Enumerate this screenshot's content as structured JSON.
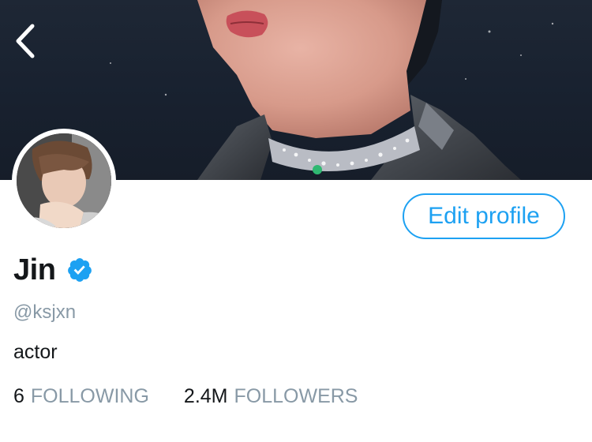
{
  "header": {
    "back_icon": "chevron-left-icon"
  },
  "profile": {
    "display_name": "Jin",
    "verified_icon": "verified-badge-icon",
    "handle": "@ksjxn",
    "bio": "actor",
    "edit_button_label": "Edit profile"
  },
  "stats": {
    "following_count": "6",
    "following_label": "FOLLOWING",
    "followers_count": "2.4M",
    "followers_label": "FOLLOWERS"
  },
  "colors": {
    "accent": "#1da1f2",
    "muted_text": "#8899a6",
    "primary_text": "#14171a"
  }
}
